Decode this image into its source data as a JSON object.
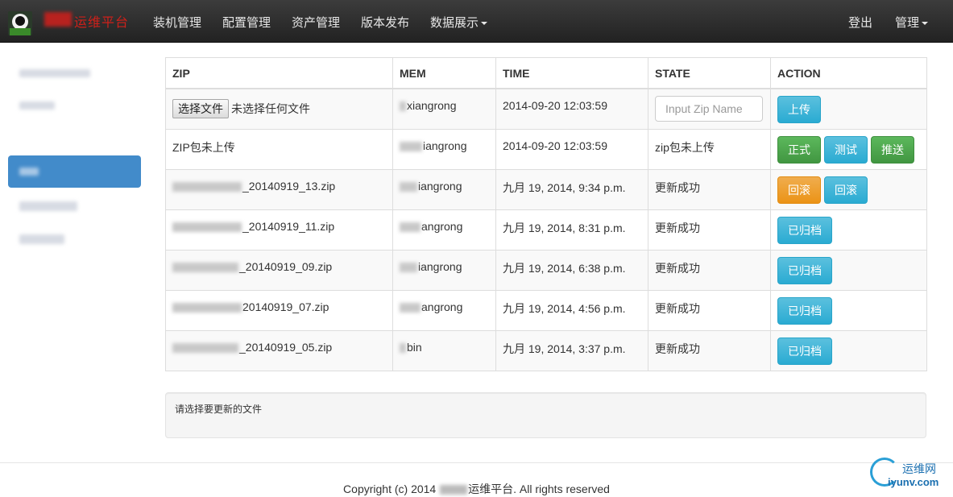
{
  "brand": {
    "text": "运维平台"
  },
  "nav": {
    "items": [
      "装机管理",
      "配置管理",
      "资产管理",
      "版本发布",
      "数据展示"
    ],
    "logout": "登出",
    "admin": "管理"
  },
  "table": {
    "headers": [
      "ZIP",
      "MEM",
      "TIME",
      "STATE",
      "ACTION"
    ],
    "upload_row": {
      "file_button": "选择文件",
      "file_status": "未选择任何文件",
      "mem": "xiangrong",
      "time": "2014-09-20 12:03:59",
      "input_placeholder": "Input Zip Name",
      "upload_button": "上传"
    },
    "pending_row": {
      "zip": "ZIP包未上传",
      "mem": "iangrong",
      "time": "2014-09-20 12:03:59",
      "state": "zip包未上传",
      "buttons": [
        "正式",
        "测试",
        "推送"
      ]
    },
    "rows": [
      {
        "zip": "_20140919_13.zip",
        "mem": "iangrong",
        "time": "九月 19, 2014, 9:34 p.m.",
        "state": "更新成功",
        "buttons": [
          "回滚",
          "回滚"
        ]
      },
      {
        "zip": "_20140919_11.zip",
        "mem": "angrong",
        "time": "九月 19, 2014, 8:31 p.m.",
        "state": "更新成功",
        "buttons": [
          "已归档"
        ]
      },
      {
        "zip": "_20140919_09.zip",
        "mem": "iangrong",
        "time": "九月 19, 2014, 6:38 p.m.",
        "state": "更新成功",
        "buttons": [
          "已归档"
        ]
      },
      {
        "zip": "20140919_07.zip",
        "mem": "angrong",
        "time": "九月 19, 2014, 4:56 p.m.",
        "state": "更新成功",
        "buttons": [
          "已归档"
        ]
      },
      {
        "zip": "_20140919_05.zip",
        "mem": "bin",
        "time": "九月 19, 2014, 3:37 p.m.",
        "state": "更新成功",
        "buttons": [
          "已归档"
        ]
      }
    ]
  },
  "message": "请选择要更新的文件",
  "footer": {
    "prefix": "Copyright (c) 2014",
    "suffix": "运维平台. All rights reserved"
  },
  "watermark": {
    "cn": "运维网",
    "url": "iyunv.com"
  },
  "colors": {
    "primary": "#428bca",
    "info": "#5bc0de",
    "success": "#5cb85c",
    "warning": "#f0ad4e",
    "brand_red": "#d0201a"
  }
}
